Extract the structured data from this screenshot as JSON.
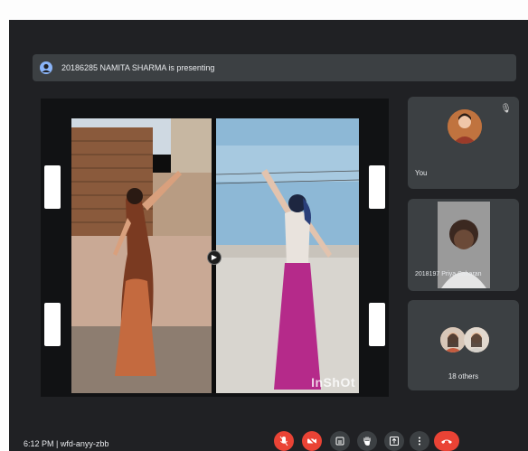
{
  "presenting": {
    "text": "20186285 NAMITA SHARMA is presenting",
    "icon": "presenter-avatar-icon"
  },
  "shared_screen": {
    "watermark": "InShOt",
    "divider_icon": "play-icon"
  },
  "participants": {
    "you": {
      "label": "You",
      "icon": "mic-off-icon"
    },
    "second": {
      "label": "2018197 Priya Saharan"
    },
    "others": {
      "label": "18 others"
    }
  },
  "footer": {
    "time_code": "6:12 PM  |  wfd-anyy-zbb"
  },
  "controls": [
    {
      "name": "mic-off-button",
      "icon": "mic-off-icon",
      "color": "#ea4335"
    },
    {
      "name": "camera-off-button",
      "icon": "camera-off-icon",
      "color": "#ea4335"
    },
    {
      "name": "captions-button",
      "icon": "captions-icon",
      "color": "#3c4043"
    },
    {
      "name": "raise-hand-button",
      "icon": "hand-icon",
      "color": "#3c4043"
    },
    {
      "name": "present-button",
      "icon": "present-icon",
      "color": "#3c4043"
    },
    {
      "name": "more-options-button",
      "icon": "more-vert-icon",
      "color": "#3c4043"
    },
    {
      "name": "end-call-button",
      "icon": "call-end-icon",
      "color": "#ea4335"
    }
  ]
}
